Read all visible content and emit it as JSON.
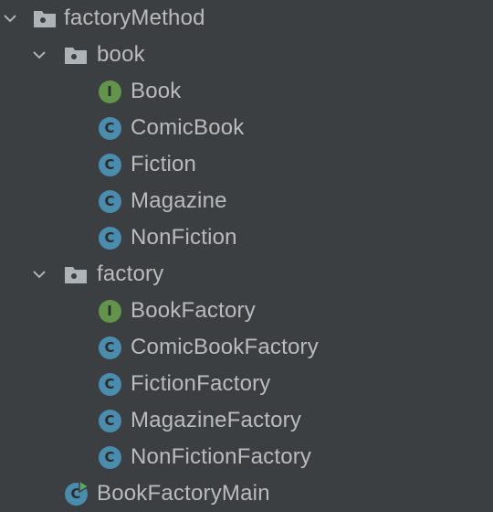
{
  "colors": {
    "background": "#3c3f41",
    "text": "#bbbbbb",
    "class_icon": "#4a8cad",
    "interface_icon": "#62944b",
    "folder_icon": "#aeb3b8",
    "run_marker": "#59a869"
  },
  "project_tree": {
    "root": {
      "label": "factoryMethod",
      "icon": "package-folder-icon",
      "expanded": true
    },
    "book_package": {
      "label": "book",
      "icon": "package-folder-icon",
      "expanded": true,
      "items": [
        {
          "label": "Book",
          "kind": "interface",
          "glyph": "I"
        },
        {
          "label": "ComicBook",
          "kind": "class",
          "glyph": "C"
        },
        {
          "label": "Fiction",
          "kind": "class",
          "glyph": "C"
        },
        {
          "label": "Magazine",
          "kind": "class",
          "glyph": "C"
        },
        {
          "label": "NonFiction",
          "kind": "class",
          "glyph": "C"
        }
      ]
    },
    "factory_package": {
      "label": "factory",
      "icon": "package-folder-icon",
      "expanded": true,
      "items": [
        {
          "label": "BookFactory",
          "kind": "interface",
          "glyph": "I"
        },
        {
          "label": "ComicBookFactory",
          "kind": "class",
          "glyph": "C"
        },
        {
          "label": "FictionFactory",
          "kind": "class",
          "glyph": "C"
        },
        {
          "label": "MagazineFactory",
          "kind": "class",
          "glyph": "C"
        },
        {
          "label": "NonFictionFactory",
          "kind": "class",
          "glyph": "C"
        }
      ]
    },
    "main_class": {
      "label": "BookFactoryMain",
      "kind": "runnable-class",
      "glyph": "C"
    }
  }
}
